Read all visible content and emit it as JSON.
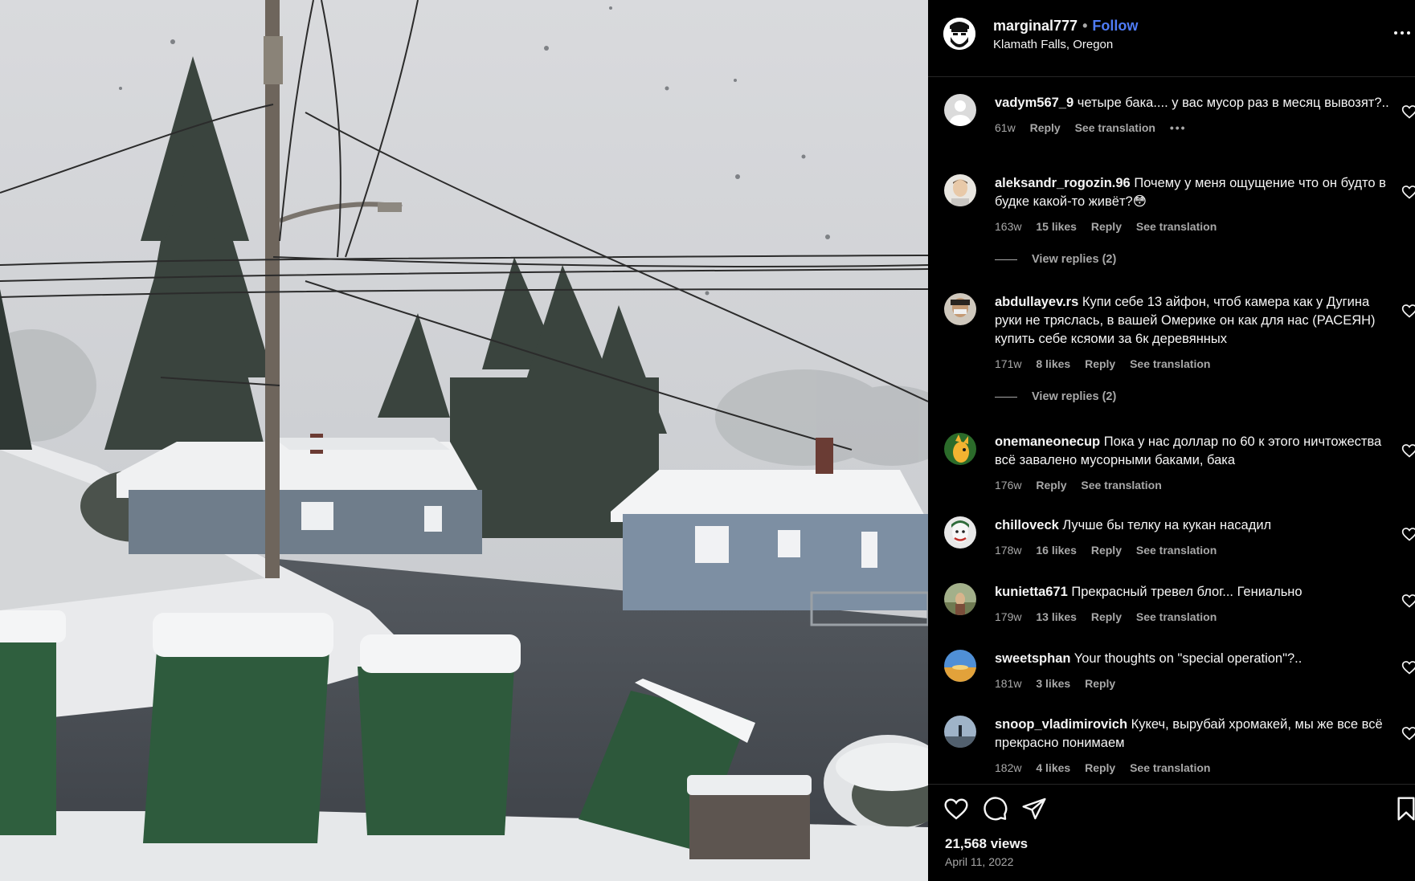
{
  "post": {
    "owner": {
      "username": "marginal777",
      "separator": "•",
      "follow_label": "Follow",
      "location": "Klamath Falls, Oregon",
      "avatar_icon": "bearded-face-avatar-icon"
    },
    "more_icon": "more-horizontal-icon",
    "views": "21,568 views",
    "date": "April 11, 2022"
  },
  "comments": [
    {
      "username": "vadym567_9",
      "text": "четыре бака.... у вас мусор раз в месяц вывозят?..",
      "time": "61w",
      "likes": "",
      "reply_label": "Reply",
      "translation_label": "See translation",
      "options": "•••",
      "avatar_icon": "default-avatar-icon",
      "view_replies": ""
    },
    {
      "username": "aleksandr_rogozin.96",
      "text": "Почему у меня ощущение что он будто в будке какой-то живёт?😳",
      "time": "163w",
      "likes": "15 likes",
      "reply_label": "Reply",
      "translation_label": "See translation",
      "options": "",
      "avatar_icon": "user-photo-avatar-icon",
      "view_replies": "View replies (2)"
    },
    {
      "username": "abdullayev.rs",
      "text": "Купи себе 13 айфон, чтоб камера как у Дугина руки не тряслась, в вашей Омерике он как для нас (РАСЕЯН) купить себе ксяоми за 6к деревянных",
      "time": "171w",
      "likes": "8 likes",
      "reply_label": "Reply",
      "translation_label": "See translation",
      "options": "",
      "avatar_icon": "user-photo-avatar-icon",
      "view_replies": "View replies (2)"
    },
    {
      "username": "onemaneonecup",
      "text": "Пока у нас доллар по 60 к этого ничтожества всё завалено мусорными баками, бака",
      "time": "176w",
      "likes": "",
      "reply_label": "Reply",
      "translation_label": "See translation",
      "options": "",
      "avatar_icon": "cartoon-avatar-icon",
      "view_replies": ""
    },
    {
      "username": "chilloveck",
      "text": "Лучше бы телку на кукан насадил",
      "time": "178w",
      "likes": "16 likes",
      "reply_label": "Reply",
      "translation_label": "See translation",
      "options": "",
      "avatar_icon": "joker-avatar-icon",
      "view_replies": ""
    },
    {
      "username": "kunietta671",
      "text": "Прекрасный тревел блог... Гениально",
      "time": "179w",
      "likes": "13 likes",
      "reply_label": "Reply",
      "translation_label": "See translation",
      "options": "",
      "avatar_icon": "outdoor-avatar-icon",
      "view_replies": ""
    },
    {
      "username": "sweetsphan",
      "text": "Your thoughts on \"special operation\"?..",
      "time": "181w",
      "likes": "3 likes",
      "reply_label": "Reply",
      "translation_label": "",
      "options": "",
      "avatar_icon": "sky-avatar-icon",
      "view_replies": ""
    },
    {
      "username": "snoop_vladimirovich",
      "text": "Кукеч, вырубай хромакей, мы же все всё прекрасно понимаем",
      "time": "182w",
      "likes": "4 likes",
      "reply_label": "Reply",
      "translation_label": "See translation",
      "options": "",
      "avatar_icon": "landscape-avatar-icon",
      "view_replies": ""
    }
  ],
  "actions": {
    "like_icon": "heart-icon",
    "comment_icon": "comment-bubble-icon",
    "share_icon": "paper-plane-icon",
    "save_icon": "bookmark-icon"
  },
  "colors": {
    "panel_bg": "#000000",
    "text_primary": "#f5f5f5",
    "text_secondary": "#a8a8a8",
    "follow_blue": "#4f7cf7"
  }
}
